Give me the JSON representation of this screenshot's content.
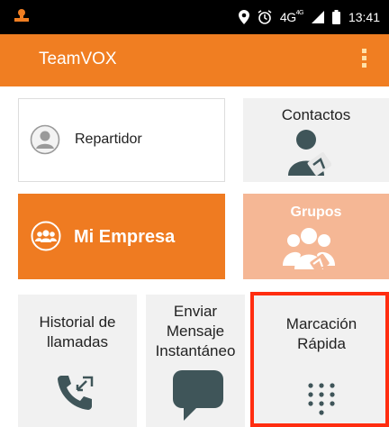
{
  "status_bar": {
    "network": "4G",
    "network_sup": "4G",
    "time": "13:41"
  },
  "app_bar": {
    "title": "TeamVOX"
  },
  "tiles": {
    "repartidor": {
      "label": "Repartidor"
    },
    "contactos": {
      "label": "Contactos"
    },
    "mi_empresa": {
      "label": "Mi Empresa"
    },
    "grupos": {
      "label": "Grupos"
    },
    "historial": {
      "label_line1": "Historial de",
      "label_line2": "llamadas"
    },
    "enviar": {
      "label_line1": "Enviar",
      "label_line2": "Mensaje",
      "label_line3": "Instantáneo"
    },
    "marcacion": {
      "label_line1": "Marcación",
      "label_line2": "Rápida"
    }
  },
  "colors": {
    "accent": "#f07e22",
    "accent_light": "#f5b795",
    "highlight": "#ff2d10",
    "icon_dark": "#3f5559"
  }
}
